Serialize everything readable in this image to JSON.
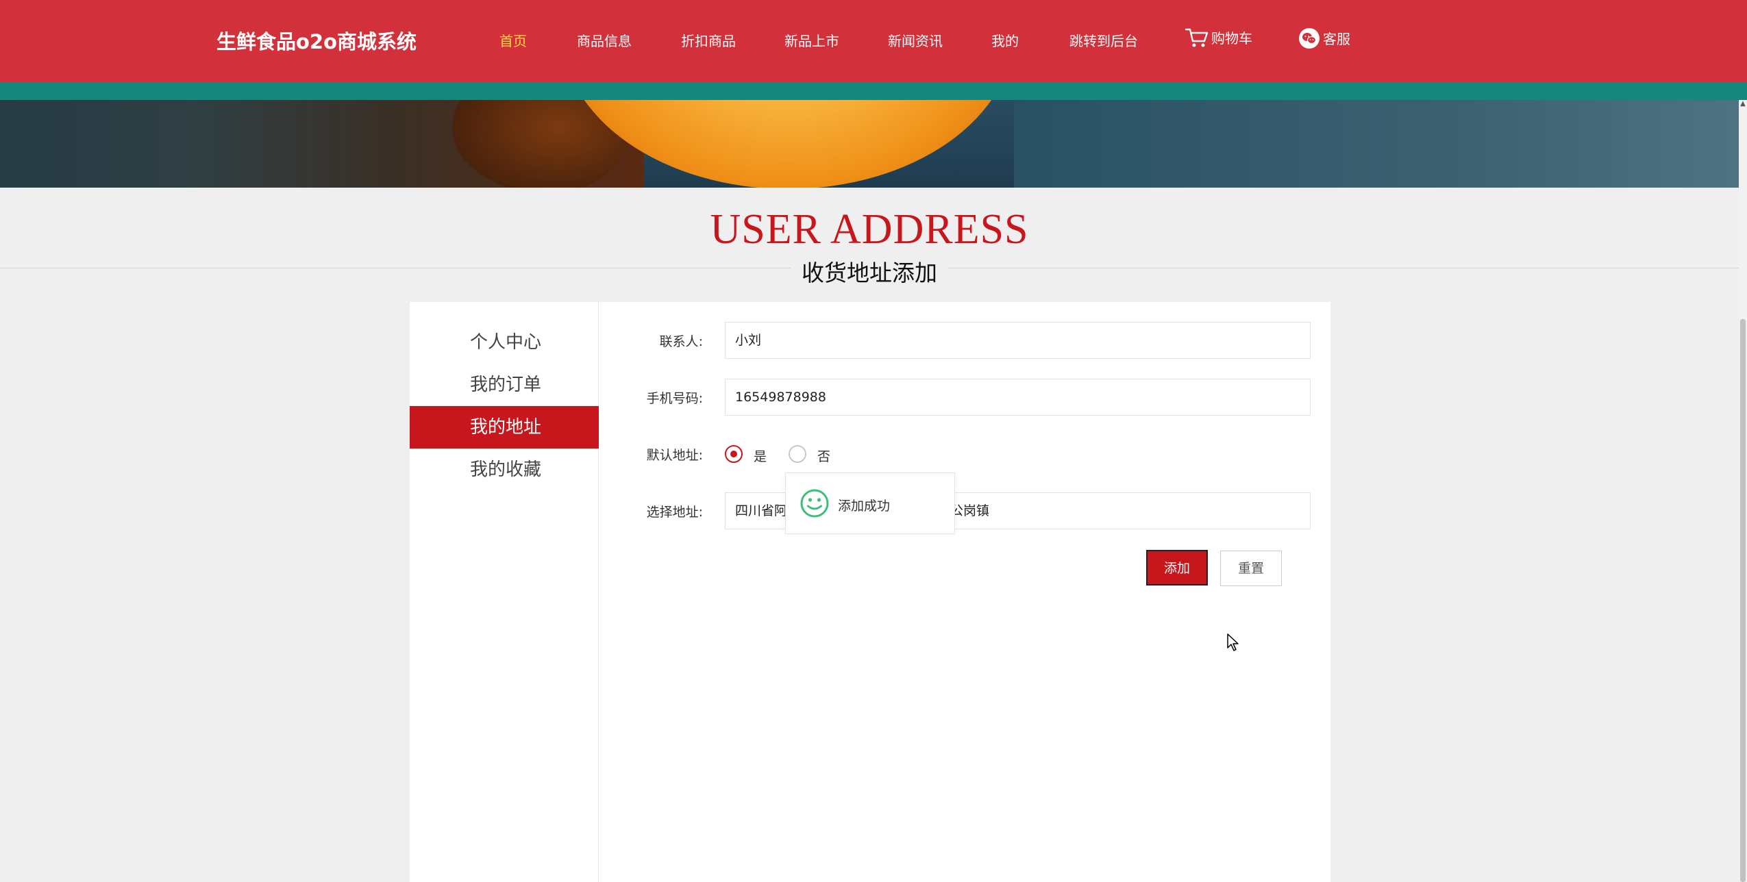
{
  "header": {
    "brand": "生鲜食品o2o商城系统",
    "nav": [
      {
        "label": "首页",
        "active": true
      },
      {
        "label": "商品信息"
      },
      {
        "label": "折扣商品"
      },
      {
        "label": "新品上市"
      },
      {
        "label": "新闻资讯"
      },
      {
        "label": "我的"
      },
      {
        "label": "跳转到后台"
      },
      {
        "label": "购物车",
        "icon": "cart-icon"
      },
      {
        "label": "客服",
        "icon": "wechat-icon"
      }
    ]
  },
  "page": {
    "title_en": "USER ADDRESS",
    "title_cn": "收货地址添加"
  },
  "sidebar": {
    "items": [
      {
        "label": "个人中心"
      },
      {
        "label": "我的订单"
      },
      {
        "label": "我的地址",
        "active": true
      },
      {
        "label": "我的收藏"
      }
    ]
  },
  "form": {
    "contact": {
      "label": "联系人:",
      "value": "小刘"
    },
    "phone": {
      "label": "手机号码:",
      "value": "16549878988"
    },
    "default_address": {
      "label": "默认地址:",
      "options": [
        "是",
        "否"
      ],
      "selected": "是"
    },
    "address": {
      "label": "选择地址:",
      "value_visible_left": "四川省阿",
      "value_visible_right": "公岗镇"
    },
    "add_label": "添加",
    "reset_label": "重置"
  },
  "toast": {
    "text": "添加成功",
    "icon": "smile-icon"
  },
  "colors": {
    "header_red": "#d2303a",
    "teal": "#17877b",
    "accent_red": "#c8161d",
    "active_nav": "#ffd94a",
    "toast_green": "#3cbf7a"
  }
}
